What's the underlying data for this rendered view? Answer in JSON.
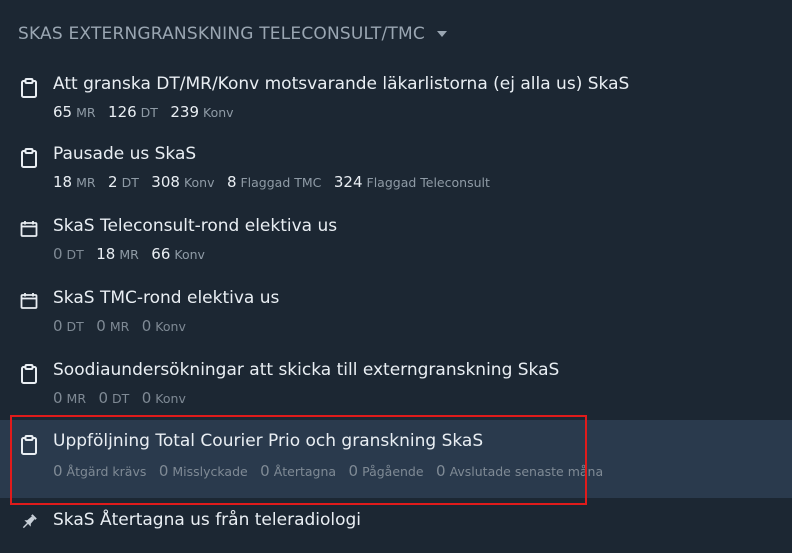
{
  "header": {
    "title": "SKAS EXTERNGRANSKNING TELECONSULT/TMC"
  },
  "items": [
    {
      "title": "Att granska DT/MR/Konv motsvarande läkarlistorna (ej alla us) SkaS",
      "icon": "clipboard-icon",
      "stats": [
        {
          "num": "65",
          "label": "MR"
        },
        {
          "num": "126",
          "label": "DT"
        },
        {
          "num": "239",
          "label": "Konv"
        }
      ]
    },
    {
      "title": "Pausade us SkaS",
      "icon": "clipboard-icon",
      "stats": [
        {
          "num": "18",
          "label": "MR"
        },
        {
          "num": "2",
          "label": "DT"
        },
        {
          "num": "308",
          "label": "Konv"
        },
        {
          "num": "8",
          "label": "Flaggad TMC"
        },
        {
          "num": "324",
          "label": "Flaggad Teleconsult"
        }
      ]
    },
    {
      "title": "SkaS Teleconsult-rond elektiva us",
      "icon": "calendar-icon",
      "stats": [
        {
          "num": "0",
          "label": "DT"
        },
        {
          "num": "18",
          "label": "MR"
        },
        {
          "num": "66",
          "label": "Konv"
        }
      ]
    },
    {
      "title": "SkaS TMC-rond elektiva us",
      "icon": "calendar-icon",
      "stats": [
        {
          "num": "0",
          "label": "DT"
        },
        {
          "num": "0",
          "label": "MR"
        },
        {
          "num": "0",
          "label": "Konv"
        }
      ]
    },
    {
      "title": "Soodiaundersökningar att skicka till externgranskning SkaS",
      "icon": "clipboard-icon",
      "stats": [
        {
          "num": "0",
          "label": "MR"
        },
        {
          "num": "0",
          "label": "DT"
        },
        {
          "num": "0",
          "label": "Konv"
        }
      ]
    },
    {
      "title": "Uppföljning Total Courier Prio och granskning SkaS",
      "icon": "clipboard-icon",
      "stats": [
        {
          "num": "0",
          "label": "Åtgärd krävs"
        },
        {
          "num": "0",
          "label": "Misslyckade"
        },
        {
          "num": "0",
          "label": "Återtagna"
        },
        {
          "num": "0",
          "label": "Pågående"
        },
        {
          "num": "0",
          "label": "Avslutade senaste måna"
        }
      ]
    },
    {
      "title": "SkaS Återtagna us från teleradiologi",
      "icon": "pin-icon",
      "stats": []
    }
  ],
  "colors": {
    "background": "#1c2733",
    "selected_background": "#2a3a4d",
    "highlight_border": "#e01b1b",
    "text": "#e9eef3",
    "muted": "#7f8a95"
  }
}
